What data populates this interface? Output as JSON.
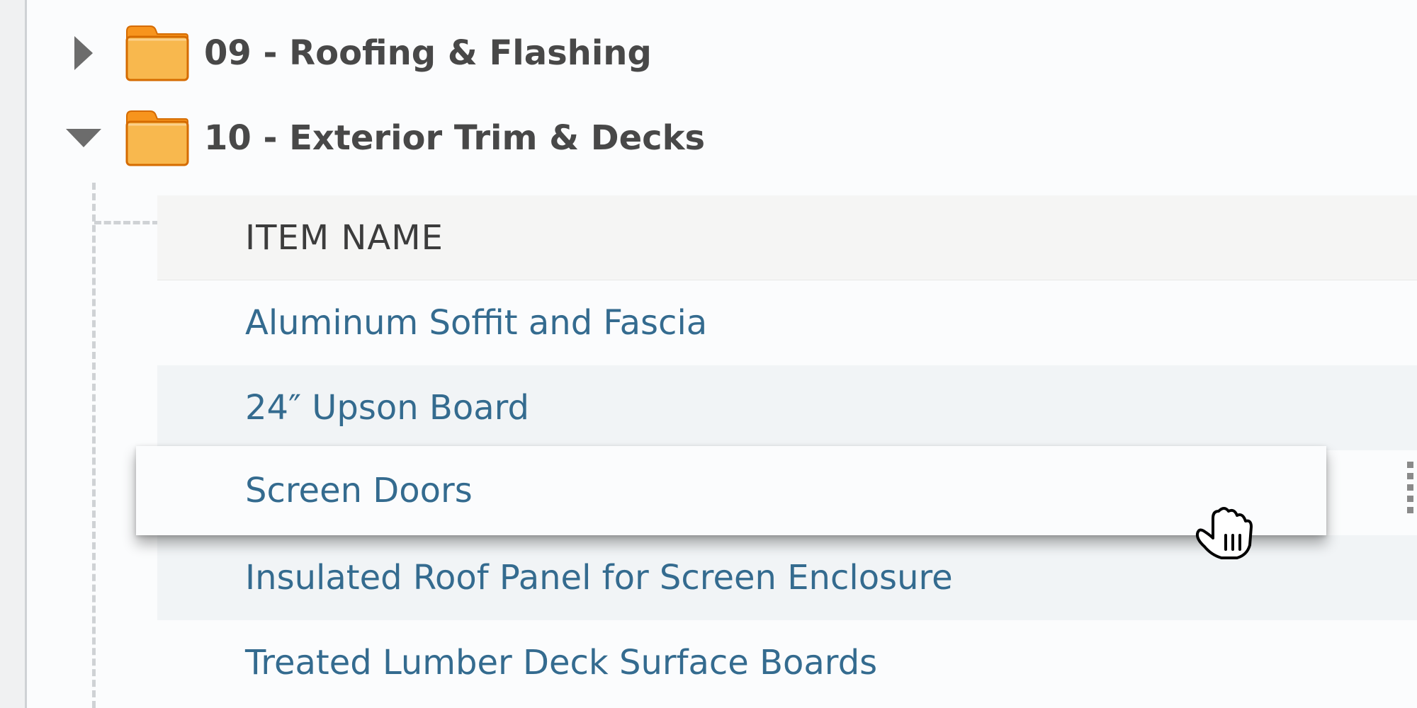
{
  "tree": {
    "folders": [
      {
        "label": "09 - Roofing & Flashing",
        "expanded": false
      },
      {
        "label": "10 - Exterior Trim & Decks",
        "expanded": true
      }
    ]
  },
  "table": {
    "header": "ITEM NAME",
    "items": [
      "Aluminum Soffit and Fascia",
      "24″ Upson Board",
      "Screen Doors",
      "Insulated Roof Panel for Screen Enclosure",
      "Treated Lumber Deck Surface Boards"
    ],
    "dragging_item_index": 2
  },
  "icons": {
    "collapsed_toggle": "caret-right-icon",
    "expanded_toggle": "caret-down-icon",
    "folder": "folder-icon",
    "drag_handle": "drag-handle-icon",
    "cursor": "grab-hand-cursor-icon"
  },
  "colors": {
    "folder_fill": "#f8b84e",
    "folder_tab": "#f7941d",
    "folder_border": "#d56b00",
    "item_text": "#346b8f",
    "header_bg": "#f5f5f4",
    "row_shaded_bg": "#f1f4f6"
  }
}
